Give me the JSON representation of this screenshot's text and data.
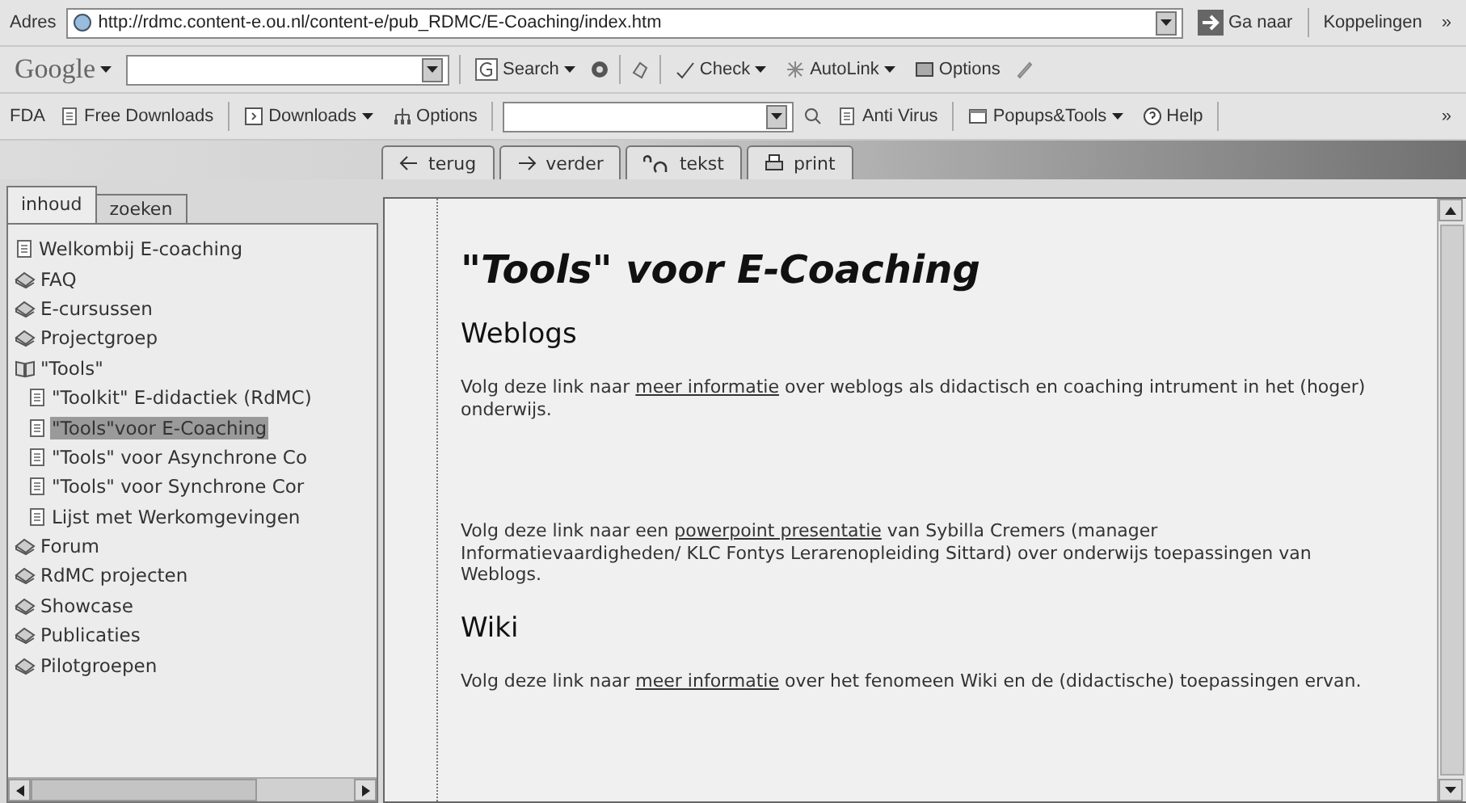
{
  "address_bar": {
    "label": "Adres",
    "url": "http://rdmc.content-e.ou.nl/content-e/pub_RDMC/E-Coaching/index.htm",
    "go": "Ga naar",
    "links": "Koppelingen",
    "more": "»"
  },
  "google_toolbar": {
    "brand": "Google",
    "search": "Search",
    "check": "Check",
    "autolink": "AutoLink",
    "options": "Options"
  },
  "fda_toolbar": {
    "label": "FDA",
    "items": [
      {
        "kind": "page",
        "text": "Free Downloads"
      },
      {
        "kind": "menu",
        "text": "Downloads"
      },
      {
        "kind": "options",
        "text": "Options"
      }
    ],
    "antivirus": "Anti Virus",
    "popups": "Popups&Tools",
    "help": "Help",
    "more": "»"
  },
  "nav_buttons": [
    {
      "kind": "back",
      "text": "terug"
    },
    {
      "kind": "forward",
      "text": "verder"
    },
    {
      "kind": "text",
      "text": "tekst"
    },
    {
      "kind": "print",
      "text": "print"
    }
  ],
  "side_tabs": [
    {
      "label": "inhoud",
      "selected": true
    },
    {
      "label": "zoeken",
      "selected": false
    }
  ],
  "tree": [
    {
      "kind": "page",
      "label": "Welkombij E-coaching",
      "selected": false
    },
    {
      "kind": "book",
      "label": "FAQ",
      "expanded": false,
      "selected": false
    },
    {
      "kind": "book",
      "label": "E-cursussen",
      "expanded": false,
      "selected": false
    },
    {
      "kind": "book",
      "label": "Projectgroep",
      "expanded": false,
      "selected": false
    },
    {
      "kind": "book",
      "label": "\"Tools\"",
      "expanded": true,
      "selected": false,
      "children": [
        {
          "kind": "page",
          "label": "\"Toolkit\" E-didactiek (RdMC)",
          "selected": false
        },
        {
          "kind": "page",
          "label": "\"Tools\"voor E-Coaching",
          "selected": true
        },
        {
          "kind": "page",
          "label": "\"Tools\" voor Asynchrone Co",
          "selected": false
        },
        {
          "kind": "page",
          "label": "\"Tools\" voor Synchrone Cor",
          "selected": false
        },
        {
          "kind": "page",
          "label": "Lijst met Werkomgevingen",
          "selected": false
        }
      ]
    },
    {
      "kind": "book",
      "label": "Forum",
      "expanded": false,
      "selected": false
    },
    {
      "kind": "book",
      "label": "RdMC projecten",
      "expanded": false,
      "selected": false
    },
    {
      "kind": "book",
      "label": "Showcase",
      "expanded": false,
      "selected": false
    },
    {
      "kind": "book",
      "label": "Publicaties",
      "expanded": false,
      "selected": false
    },
    {
      "kind": "book",
      "label": "Pilotgroepen",
      "expanded": false,
      "selected": false
    }
  ],
  "content": {
    "title": "\"Tools\" voor E-Coaching",
    "blocks": [
      {
        "kind": "heading",
        "text": "Weblogs"
      },
      {
        "kind": "paragraph",
        "before": "Volg deze link naar ",
        "link": "meer informatie",
        "after": " over weblogs als didactisch en coaching intrument in het (hoger) onderwijs."
      },
      {
        "kind": "paragraph",
        "spaced": true,
        "before": "Volg deze link naar een ",
        "link": "powerpoint presentatie",
        "after": " van Sybilla Cremers (manager Informatievaardigheden/ KLC Fontys Lerarenopleiding Sittard) over onderwijs toepassingen van Weblogs."
      },
      {
        "kind": "heading",
        "text": "Wiki"
      },
      {
        "kind": "paragraph",
        "before": "Volg deze link naar ",
        "link": "meer informatie",
        "after": " over het fenomeen Wiki en de (didactische) toepassingen ervan."
      }
    ]
  }
}
